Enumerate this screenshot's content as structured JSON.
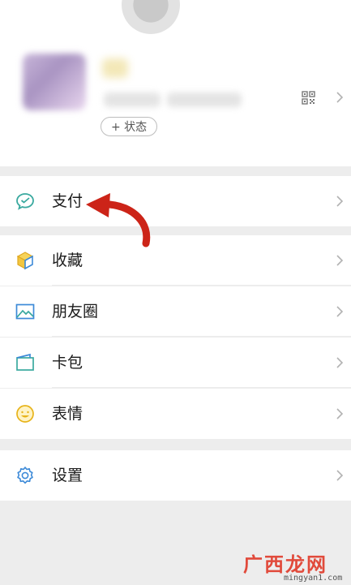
{
  "profile": {
    "status_label": "+ 状态"
  },
  "menu": {
    "pay": "支付",
    "favorites": "收藏",
    "moments": "朋友圈",
    "cards": "卡包",
    "stickers": "表情",
    "settings": "设置"
  },
  "watermark": {
    "logo": "广西龙网",
    "url": "mingyan1.com"
  },
  "colors": {
    "icon_teal": "#3aa99f",
    "icon_blue": "#3d8ad8",
    "icon_yellow": "#e7b319",
    "arrow_red": "#cc2418",
    "background": "#ededed"
  }
}
